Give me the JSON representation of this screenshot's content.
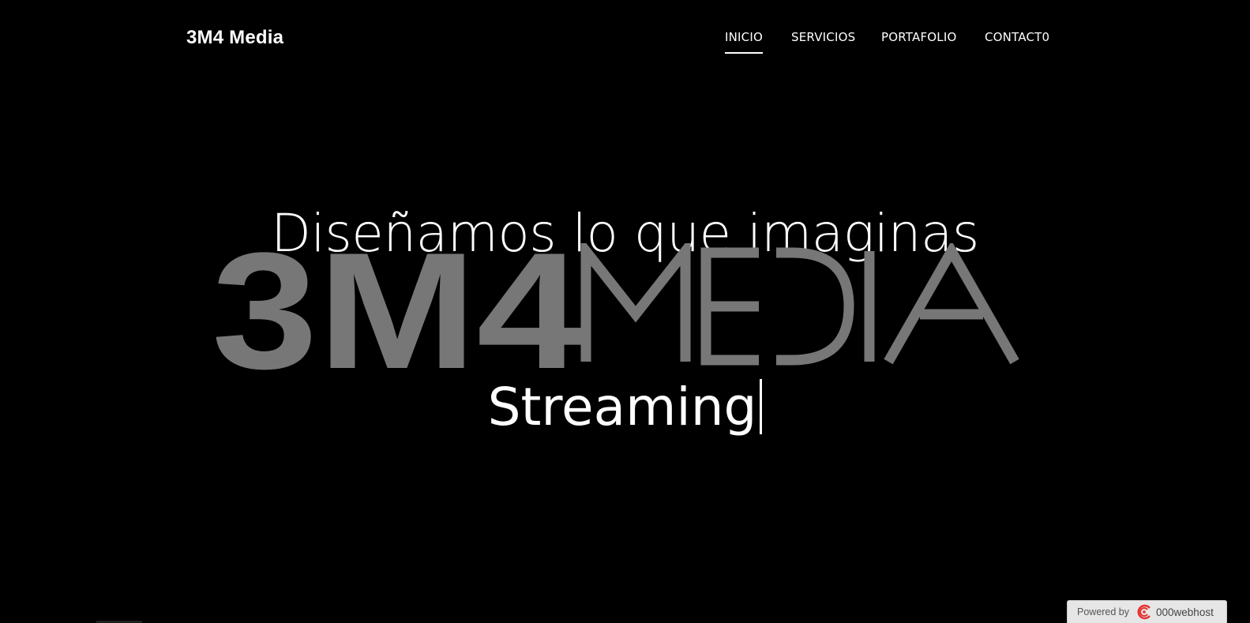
{
  "header": {
    "brand": "3M4 Media",
    "nav": [
      {
        "label": "INICIO",
        "active": true
      },
      {
        "label": "SERVICIOS",
        "active": false
      },
      {
        "label": "PORTAFOLIO",
        "active": false
      },
      {
        "label": "CONTACT0",
        "active": false
      }
    ]
  },
  "hero": {
    "tagline": "Diseñamos lo que imaginas",
    "logo": {
      "bold_text": "3M4",
      "light_text": "MEDIA",
      "color": "#777777"
    },
    "typed_text": "Streaming"
  },
  "footer_badge": {
    "powered_by": "Powered by",
    "host_name": "000webhost",
    "host_logo_color": "#e8312f"
  },
  "colors": {
    "background": "#000000",
    "text": "#ffffff"
  }
}
